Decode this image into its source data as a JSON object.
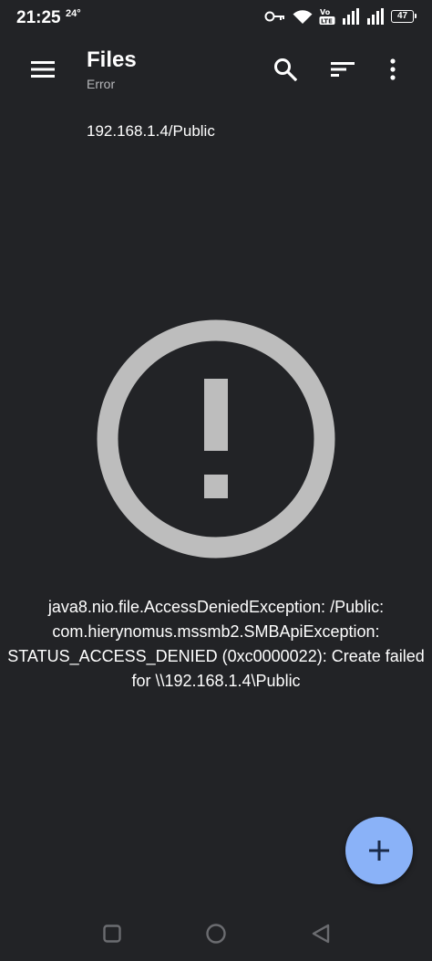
{
  "status_bar": {
    "time": "21:25",
    "temperature": "24°",
    "battery_level": "47",
    "icons": [
      "key-icon",
      "wifi-icon",
      "volte-lte-icon",
      "signal-icon",
      "signal-icon",
      "battery-icon"
    ]
  },
  "toolbar": {
    "title": "Files",
    "subtitle": "Error",
    "menu_icon": "menu-icon",
    "search_icon": "search-icon",
    "sort_icon": "sort-icon",
    "more_icon": "more-vert-icon"
  },
  "breadcrumb": {
    "path": "192.168.1.4/Public"
  },
  "error": {
    "icon": "error-icon",
    "message": "java8.nio.file.AccessDeniedException: /Public: com.hierynomus.mssmb2.SMBApiException: STATUS_ACCESS_DENIED (0xc0000022): Create failed for \\\\192.168.1.4\\Public"
  },
  "fab": {
    "icon": "add-icon"
  },
  "colors": {
    "background": "#222326",
    "text": "#ffffff",
    "subtitle": "#b7b8bb",
    "error_icon": "#bdbdbd",
    "fab": "#8ab2f8",
    "fab_icon": "#1a2a48",
    "nav_icons": "#6b6c70"
  }
}
